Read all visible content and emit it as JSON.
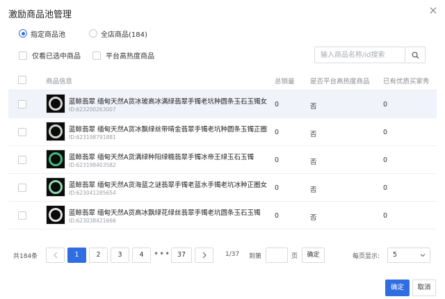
{
  "dialog": {
    "title": "激励商品池管理"
  },
  "scope": [
    {
      "label": "指定商品池",
      "selected": true
    },
    {
      "label": "全店商品(184)",
      "selected": false
    }
  ],
  "filters": [
    {
      "label": "仅看已选中商品"
    },
    {
      "label": "平台高热度商品"
    }
  ],
  "search": {
    "placeholder": "输入商品名称/id搜索",
    "value": ""
  },
  "table": {
    "columns": [
      "商品信息",
      "总销量",
      "是否平台高热度商品",
      "已有优质买家秀"
    ],
    "rows": [
      {
        "name": "蓝鲸翡翠 缅甸天然A货冰玻高冰满绿翡翠手镯老坑种圆条玉石玉镯女",
        "id": "ID:623200263007",
        "sales": "0",
        "hot": "否",
        "show": "0",
        "ring": "#d9d9d9"
      },
      {
        "name": "蓝鲸翡翠 缅甸天然A货冰飘绿丝带晴金翡翠手镯老坑种圆条玉镯正圈",
        "id": "ID:623198791881",
        "sales": "0",
        "hot": "否",
        "show": "0",
        "ring": "#cfd6cf"
      },
      {
        "name": "蓝鲸翡翠 缅甸天然A货满绿种阳绿糯翡翠手镯冰帝王绿玉石玉镯",
        "id": "ID:623198403582",
        "sales": "0",
        "hot": "否",
        "show": "0",
        "ring": "#3fbf7a"
      },
      {
        "name": "蓝鲸翡翠 缅甸天然A货海蓝之谜翡翠手镯老蓝水手镯老坑冰种正圈女",
        "id": "ID:623041285654",
        "sales": "0",
        "hot": "否",
        "show": "0",
        "ring": "#8fd9b0"
      },
      {
        "name": "蓝鲸翡翠 缅甸天然A货高冰飘绿花绿丝翡翠手镯老坑圆条玉石玉镯",
        "id": "ID:623038421666",
        "sales": "0",
        "hot": "否",
        "show": "0",
        "ring": "#e6e6e6"
      }
    ]
  },
  "pager": {
    "total": "共184条",
    "prev": "<",
    "pages": [
      "1",
      "2",
      "3",
      "4"
    ],
    "dots": "•••",
    "last": "37",
    "next": ">",
    "page_info": "1/37",
    "goto_label": "到第",
    "goto_unit": "页",
    "goto_confirm": "确定",
    "page_size_label": "每页显示:",
    "page_size": "5"
  },
  "footer": {
    "ok": "确定",
    "cancel": "取消"
  },
  "colors": {
    "primary": "#2f6de0"
  }
}
